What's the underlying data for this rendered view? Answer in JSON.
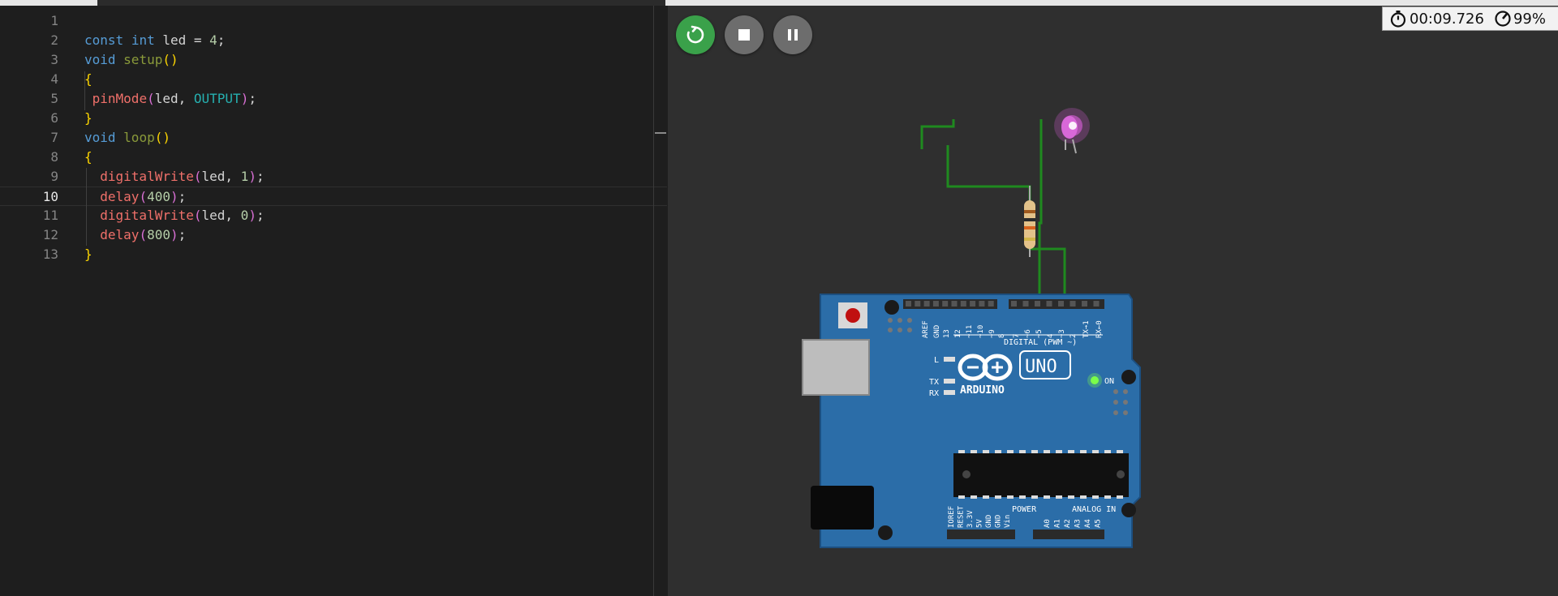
{
  "editor": {
    "lines": [
      {
        "num": "1",
        "tokens": []
      },
      {
        "num": "2",
        "tokens": [
          [
            "k",
            "const"
          ],
          [
            "t",
            " "
          ],
          [
            "k",
            "int"
          ],
          [
            "t",
            " led = "
          ],
          [
            "n",
            "4"
          ],
          [
            "t",
            ";"
          ]
        ]
      },
      {
        "num": "3",
        "tokens": [
          [
            "k",
            "void"
          ],
          [
            "t",
            " "
          ],
          [
            "fd",
            "setup"
          ],
          [
            "p",
            "()"
          ]
        ]
      },
      {
        "num": "4",
        "tokens": [
          [
            "p",
            "{"
          ]
        ]
      },
      {
        "num": "5",
        "tokens": [
          [
            "t",
            " "
          ],
          [
            "f",
            "pinMode"
          ],
          [
            "pk",
            "("
          ],
          [
            "t",
            "led, "
          ],
          [
            "c",
            "OUTPUT"
          ],
          [
            "pk",
            ")"
          ],
          [
            "t",
            ";"
          ]
        ]
      },
      {
        "num": "6",
        "tokens": [
          [
            "p",
            "}"
          ]
        ]
      },
      {
        "num": "7",
        "tokens": [
          [
            "k",
            "void"
          ],
          [
            "t",
            " "
          ],
          [
            "fd",
            "loop"
          ],
          [
            "p",
            "()"
          ]
        ]
      },
      {
        "num": "8",
        "tokens": [
          [
            "p",
            "{"
          ]
        ]
      },
      {
        "num": "9",
        "tokens": [
          [
            "t",
            "  "
          ],
          [
            "f",
            "digitalWrite"
          ],
          [
            "pk",
            "("
          ],
          [
            "t",
            "led, "
          ],
          [
            "n",
            "1"
          ],
          [
            "pk",
            ")"
          ],
          [
            "t",
            ";"
          ]
        ]
      },
      {
        "num": "10",
        "tokens": [
          [
            "t",
            "  "
          ],
          [
            "f",
            "delay"
          ],
          [
            "pk",
            "("
          ],
          [
            "n",
            "400"
          ],
          [
            "pk",
            ")"
          ],
          [
            "t",
            ";"
          ]
        ]
      },
      {
        "num": "11",
        "tokens": [
          [
            "t",
            "  "
          ],
          [
            "f",
            "digitalWrite"
          ],
          [
            "pk",
            "("
          ],
          [
            "t",
            "led, "
          ],
          [
            "n",
            "0"
          ],
          [
            "pk",
            ")"
          ],
          [
            "t",
            ";"
          ]
        ]
      },
      {
        "num": "12",
        "tokens": [
          [
            "t",
            "  "
          ],
          [
            "f",
            "delay"
          ],
          [
            "pk",
            "("
          ],
          [
            "n",
            "800"
          ],
          [
            "pk",
            ")"
          ],
          [
            "t",
            ";"
          ]
        ]
      },
      {
        "num": "13",
        "tokens": [
          [
            "p",
            "}"
          ]
        ]
      }
    ],
    "active_line": "10"
  },
  "toolbar": {
    "restart_icon": "restart-icon",
    "stop_icon": "stop-icon",
    "pause_icon": "pause-icon",
    "restart_color": "#3aa14a"
  },
  "status": {
    "timer": "00:09.726",
    "speed": "99%",
    "timer_icon": "stopwatch-icon",
    "speed_icon": "speedometer-icon"
  },
  "board": {
    "brand": "ARDUINO",
    "model": "UNO",
    "digital_label": "DIGITAL (PWM ~)",
    "power_label": "POWER",
    "analog_label": "ANALOG IN",
    "on_label": "ON",
    "l_label": "L",
    "tx_label": "TX",
    "rx_label": "RX",
    "top_pins_left": [
      "AREF",
      "GND",
      "13",
      "12",
      "~11",
      "~10",
      "~9",
      "8"
    ],
    "top_pins_right": [
      "7",
      "~6",
      "~5",
      "4",
      "~3",
      "2",
      "TX→1",
      "RX←0"
    ],
    "bottom_pins_power": [
      "IOREF",
      "RESET",
      "3.3V",
      "5V",
      "GND",
      "GND",
      "Vin"
    ],
    "bottom_pins_analog": [
      "A0",
      "A1",
      "A2",
      "A3",
      "A4",
      "A5"
    ],
    "board_color": "#2b6da8",
    "led_color": "#e060e0"
  }
}
